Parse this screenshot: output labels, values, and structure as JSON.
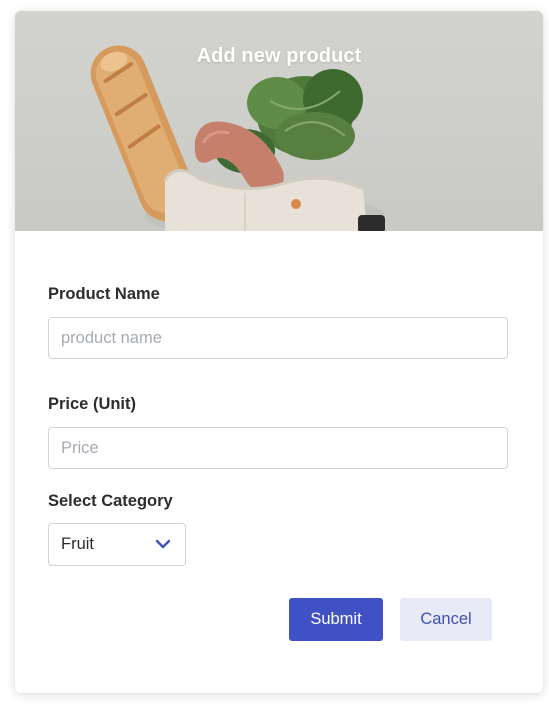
{
  "form": {
    "title": "Add new product",
    "product_name": {
      "label": "Product Name",
      "placeholder": "product name",
      "value": ""
    },
    "price": {
      "label": "Price (Unit)",
      "placeholder": "Price",
      "value": ""
    },
    "category": {
      "label": "Select Category",
      "selected": "Fruit"
    },
    "submit_label": "Submit",
    "cancel_label": "Cancel"
  },
  "banner": {
    "image": "grocery-bag-with-baguette-and-leafy-greens"
  },
  "colors": {
    "primary": "#3f51c4",
    "secondary_bg": "#e8ebf7",
    "secondary_text": "#3f4fb3",
    "banner_bg": "#cfcfcc"
  },
  "icons": {
    "select_arrow": "chevron-down-icon"
  }
}
